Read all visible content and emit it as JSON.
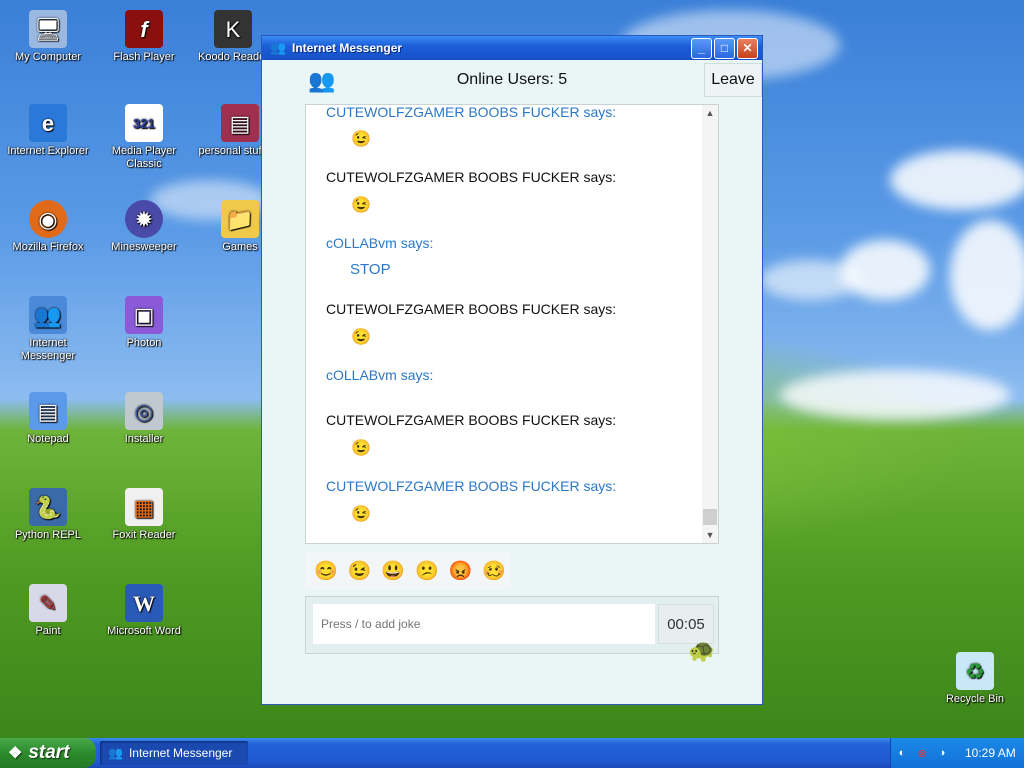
{
  "desktop": {
    "icons": [
      {
        "label": "My Computer",
        "glyph": "🖥"
      },
      {
        "label": "Flash Player",
        "glyph": "f"
      },
      {
        "label": "Koodo Reader",
        "glyph": "K"
      },
      {
        "label": "Internet Explorer",
        "glyph": "e"
      },
      {
        "label": "Media Player Classic",
        "glyph": "321"
      },
      {
        "label": "personal stuff.zip",
        "glyph": "▤"
      },
      {
        "label": "Mozilla Firefox",
        "glyph": "◉"
      },
      {
        "label": "Minesweeper",
        "glyph": "✹"
      },
      {
        "label": "Games",
        "glyph": "📁"
      },
      {
        "label": "Internet Messenger",
        "glyph": "👥"
      },
      {
        "label": "Photon",
        "glyph": "▣"
      },
      {
        "label": "Notepad",
        "glyph": "▤"
      },
      {
        "label": "Installer",
        "glyph": "◎"
      },
      {
        "label": "Python REPL",
        "glyph": "🐍"
      },
      {
        "label": "Foxit Reader",
        "glyph": "▦"
      },
      {
        "label": "Paint",
        "glyph": "✎"
      },
      {
        "label": "Microsoft Word",
        "glyph": "W"
      },
      {
        "label": "Recycle Bin",
        "glyph": "♻"
      }
    ]
  },
  "window": {
    "title": "Internet Messenger",
    "buttons": {
      "minimize": "_",
      "maximize": "□",
      "close": "✕"
    },
    "online_users": "Online Users: 5",
    "leave_label": "Leave",
    "messages": [
      {
        "name": "CUTEWOLFZGAMER BOOBS FUCKER says:",
        "style": "blue",
        "emoji": "😉"
      },
      {
        "name": "CUTEWOLFZGAMER BOOBS FUCKER says:",
        "style": "black",
        "emoji": "😉"
      },
      {
        "name": "cOLLABvm says:",
        "style": "blue",
        "text": "STOP"
      },
      {
        "name": "CUTEWOLFZGAMER BOOBS FUCKER says:",
        "style": "black",
        "emoji": "😉"
      },
      {
        "name": "cOLLABvm says:",
        "style": "blue"
      },
      {
        "name": "CUTEWOLFZGAMER BOOBS FUCKER says:",
        "style": "black",
        "emoji": "😉"
      },
      {
        "name": "CUTEWOLFZGAMER BOOBS FUCKER says:",
        "style": "blue",
        "emoji": "😉"
      }
    ],
    "emoji_bar": [
      "😊",
      "😉",
      "😃",
      "😕",
      "😡",
      "🥴"
    ],
    "input_placeholder": "Press / to add joke",
    "timer": "00:05"
  },
  "taskbar": {
    "start_label": "start",
    "task_label": "Internet Messenger",
    "clock": "10:29 AM"
  }
}
